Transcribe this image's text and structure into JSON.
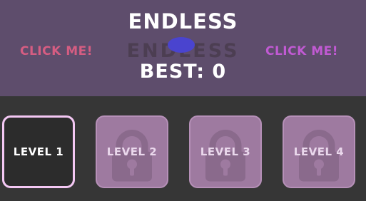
{
  "header": {
    "title": "ENDLESS",
    "ghost_text": "ENDLESS",
    "click_left": "CLICK ME!",
    "click_right": "CLICK ME!",
    "best": "BEST: 0"
  },
  "levels": [
    {
      "label": "LEVEL 1",
      "locked": false
    },
    {
      "label": "LEVEL 2",
      "locked": true
    },
    {
      "label": "LEVEL 3",
      "locked": true
    },
    {
      "label": "LEVEL 4",
      "locked": true
    }
  ],
  "colors": {
    "top_panel": "#5e4d6c",
    "background": "#363636",
    "click_left": "#d65d82",
    "click_right": "#c15ad3",
    "locked_tile": "#9e7aa0",
    "unlocked_border": "#f4c8f4",
    "blob": "#4a44cf"
  },
  "icons": {
    "lock": "padlock-icon"
  }
}
